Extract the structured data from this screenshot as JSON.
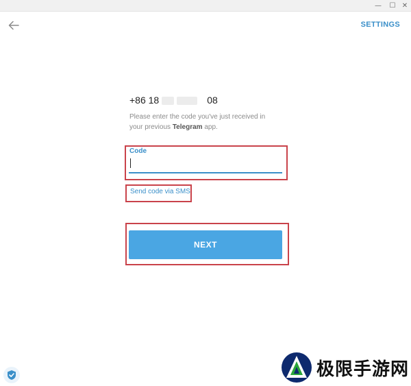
{
  "window": {
    "minimize_glyph": "—",
    "maximize_glyph": "☐",
    "close_glyph": "✕"
  },
  "nav": {
    "back_icon": "arrow-left-icon",
    "settings_label": "SETTINGS"
  },
  "login": {
    "phone_prefix": "+86 18",
    "phone_suffix": "08",
    "instruction_part1": "Please enter the code you've just received in your previous ",
    "instruction_app": "Telegram",
    "instruction_part2": " app.",
    "code_label": "Code",
    "code_value": "",
    "sms_link": "Send code via SMS",
    "next_label": "NEXT"
  },
  "footer": {
    "shield_icon": "shield-check-icon"
  },
  "watermark": {
    "text": "极限手游网"
  },
  "colors": {
    "accent": "#3a8fc9",
    "button": "#4aa6e3",
    "highlight": "#c9424a"
  }
}
